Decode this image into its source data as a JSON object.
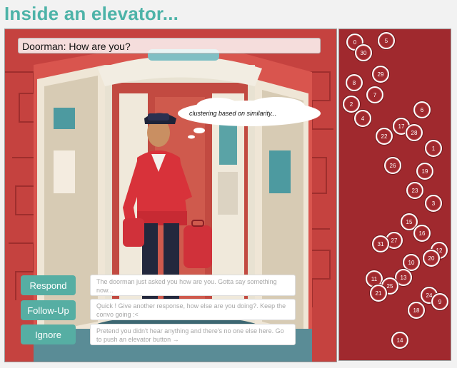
{
  "title": "Inside an elevator...",
  "speech": "Doorman: How are you?",
  "thought": "clustering based on similarity...",
  "actions": [
    {
      "label": "Respond",
      "description": "The doorman just asked you how are you. Gotta say something now..."
    },
    {
      "label": "Follow-Up",
      "description": "Quick ! Give another response, how else are you doing?. Keep the convo going :<"
    },
    {
      "label": "Ignore",
      "description": "Pretend you didn't hear anything and there's no one else here. Go to push an elevator button →"
    }
  ],
  "nodes": [
    "0",
    "5",
    "30",
    "29",
    "8",
    "7",
    "2",
    "4",
    "6",
    "17",
    "28",
    "22",
    "1",
    "26",
    "19",
    "23",
    "3",
    "15",
    "16",
    "27",
    "31",
    "12",
    "20",
    "10",
    "13",
    "11",
    "25",
    "21",
    "24",
    "9",
    "18",
    "14"
  ],
  "colors": {
    "accent": "#56aea3",
    "panel": "#a0292e",
    "scene": "#c5423f"
  }
}
